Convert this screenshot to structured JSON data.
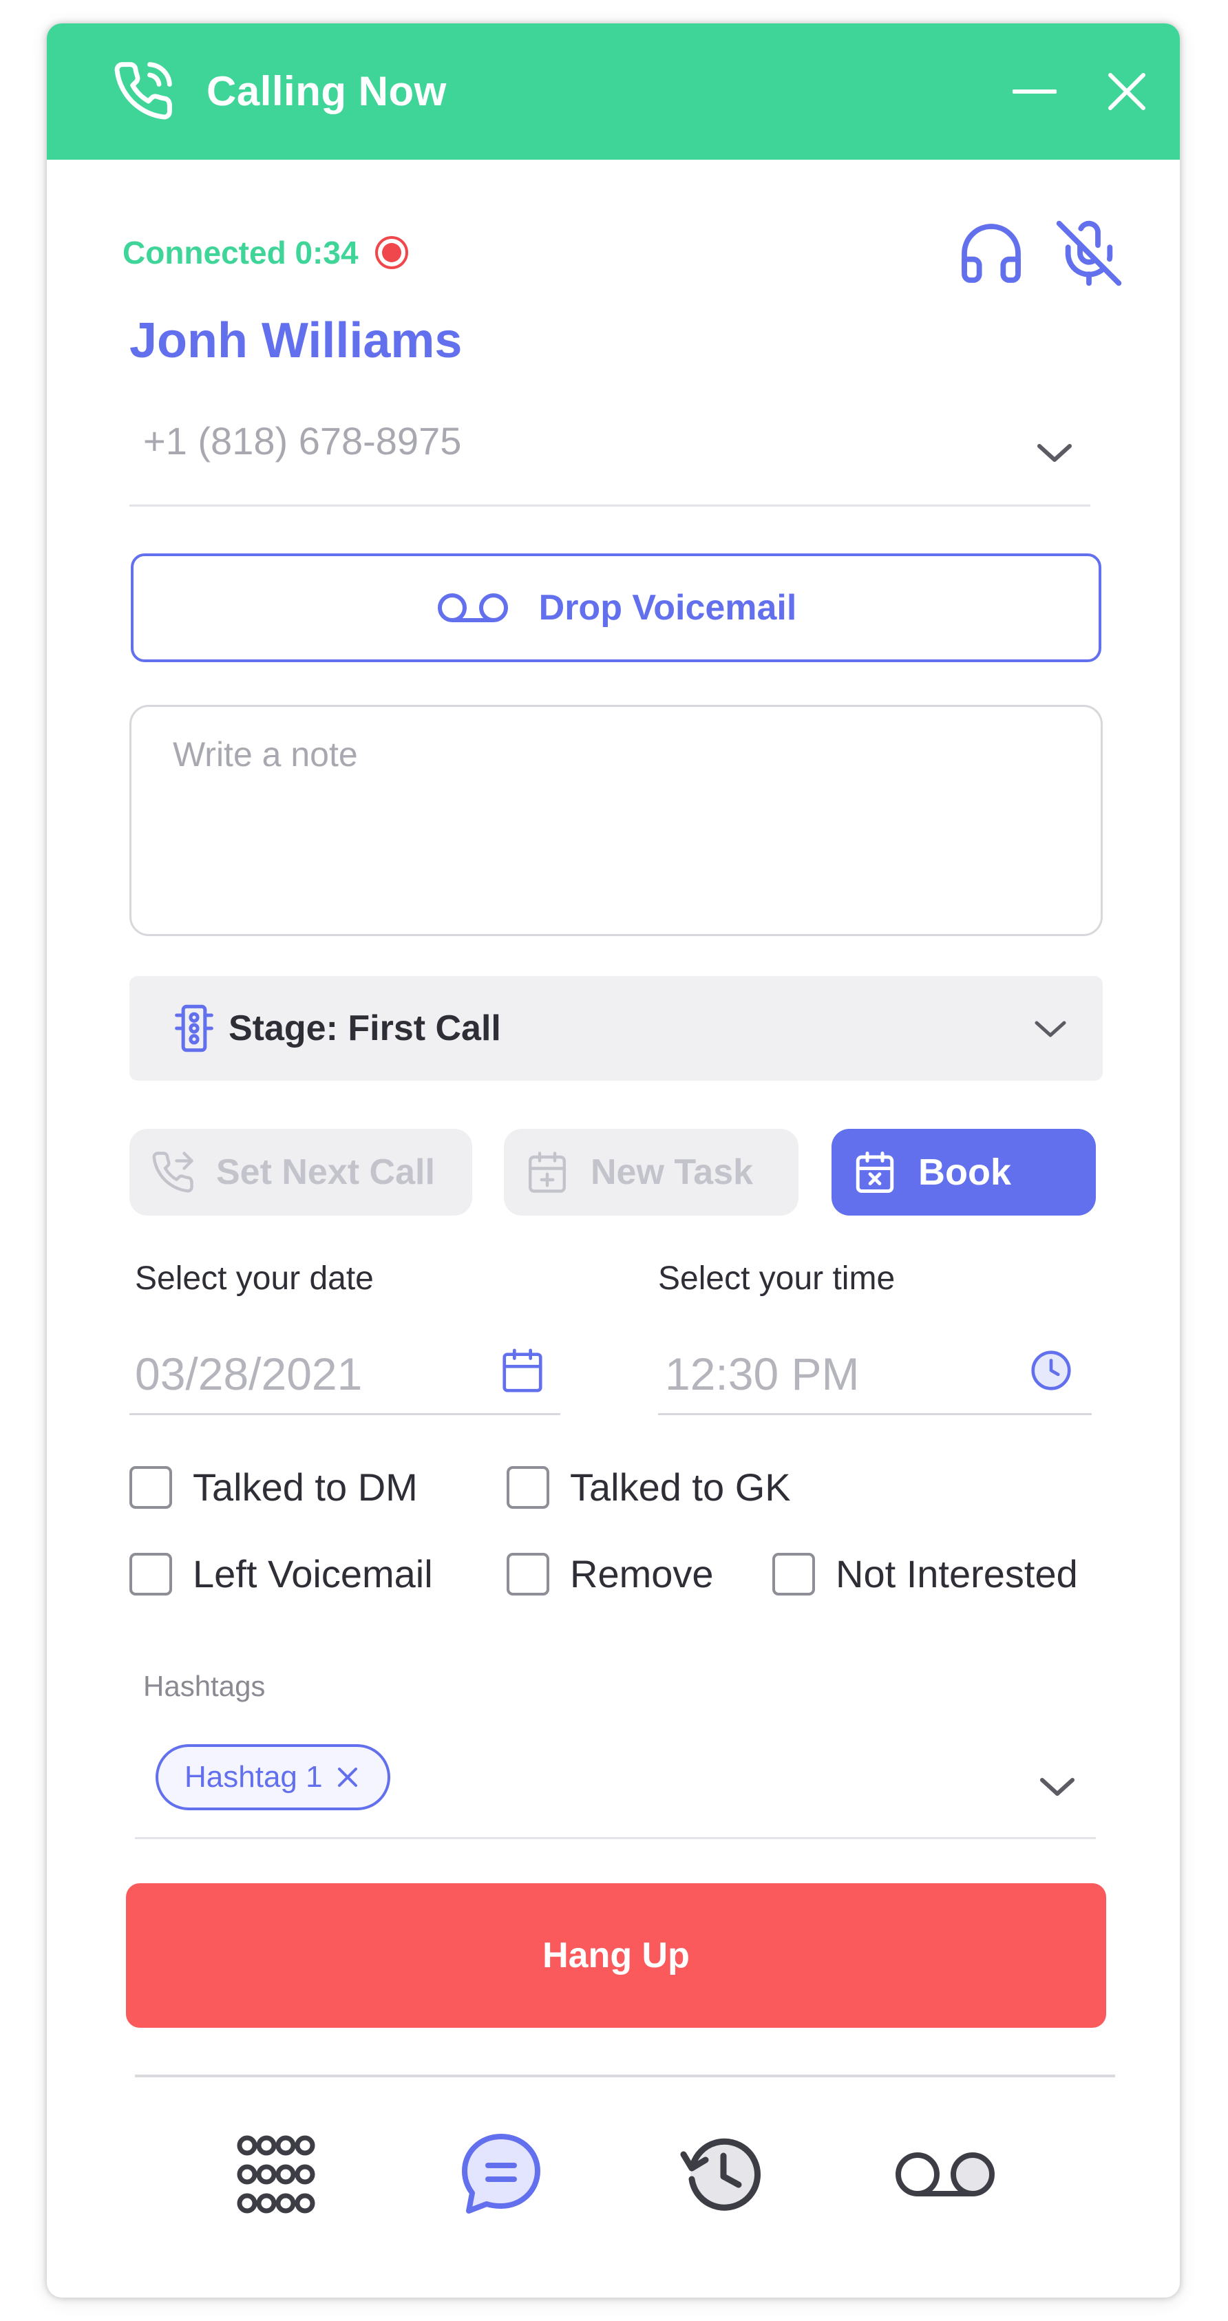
{
  "window": {
    "title": "Calling Now"
  },
  "call": {
    "status": "Connected 0:34",
    "contact_name": "Jonh Williams",
    "phone_number": "+1 (818) 678-8975"
  },
  "actions": {
    "drop_voicemail": "Drop Voicemail",
    "note_placeholder": "Write a note",
    "stage": "Stage: First Call",
    "set_next_call": "Set Next Call",
    "new_task": "New Task",
    "book": "Book"
  },
  "schedule": {
    "date_label": "Select your date",
    "date_value": "03/28/2021",
    "time_label": "Select your time",
    "time_value": "12:30 PM"
  },
  "checkboxes": [
    {
      "label": "Talked to DM",
      "checked": false
    },
    {
      "label": "Talked to GK",
      "checked": false
    },
    {
      "label": "Left Voicemail",
      "checked": false
    },
    {
      "label": "Remove",
      "checked": false
    },
    {
      "label": "Not Interested",
      "checked": false
    }
  ],
  "hashtags": {
    "label": "Hashtags",
    "items": [
      "Hashtag 1"
    ]
  },
  "hangup": "Hang Up",
  "bottom_nav": [
    {
      "icon": "keypad-icon",
      "active": false
    },
    {
      "icon": "chat-icon",
      "active": true
    },
    {
      "icon": "history-icon",
      "active": false
    },
    {
      "icon": "voicemail-icon",
      "active": false
    }
  ],
  "colors": {
    "header_green": "#3fd598",
    "accent": "#6370ee",
    "danger": "#fb5a5c",
    "recording": "#f0474c"
  }
}
